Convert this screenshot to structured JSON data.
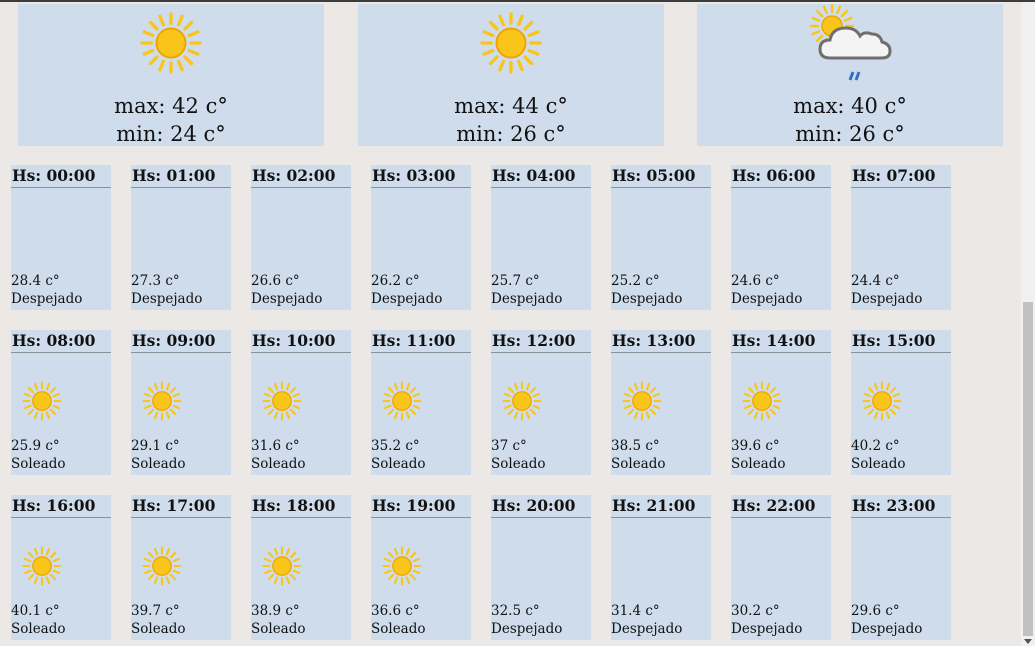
{
  "days": [
    {
      "icon": "sun-icon",
      "max": "max: 42 c°",
      "min": "min: 24 c°",
      "selected": true
    },
    {
      "icon": "sun-icon",
      "max": "max: 44 c°",
      "min": "min: 26 c°",
      "selected": false
    },
    {
      "icon": "sun-cloud-rain-icon",
      "max": "max: 40 c°",
      "min": "min: 26 c°",
      "selected": false
    }
  ],
  "hours": [
    {
      "time": "Hs: 00:00",
      "temp": "28.4 c°",
      "cond": "Despejado",
      "icon": "moon-icon"
    },
    {
      "time": "Hs: 01:00",
      "temp": "27.3 c°",
      "cond": "Despejado",
      "icon": "moon-icon"
    },
    {
      "time": "Hs: 02:00",
      "temp": "26.6 c°",
      "cond": "Despejado",
      "icon": "moon-icon"
    },
    {
      "time": "Hs: 03:00",
      "temp": "26.2 c°",
      "cond": "Despejado",
      "icon": "moon-icon"
    },
    {
      "time": "Hs: 04:00",
      "temp": "25.7 c°",
      "cond": "Despejado",
      "icon": "moon-icon"
    },
    {
      "time": "Hs: 05:00",
      "temp": "25.2 c°",
      "cond": "Despejado",
      "icon": "moon-icon"
    },
    {
      "time": "Hs: 06:00",
      "temp": "24.6 c°",
      "cond": "Despejado",
      "icon": "moon-icon"
    },
    {
      "time": "Hs: 07:00",
      "temp": "24.4 c°",
      "cond": "Despejado",
      "icon": "moon-icon"
    },
    {
      "time": "Hs: 08:00",
      "temp": "25.9 c°",
      "cond": "Soleado",
      "icon": "sun-icon"
    },
    {
      "time": "Hs: 09:00",
      "temp": "29.1 c°",
      "cond": "Soleado",
      "icon": "sun-icon"
    },
    {
      "time": "Hs: 10:00",
      "temp": "31.6 c°",
      "cond": "Soleado",
      "icon": "sun-icon"
    },
    {
      "time": "Hs: 11:00",
      "temp": "35.2 c°",
      "cond": "Soleado",
      "icon": "sun-icon"
    },
    {
      "time": "Hs: 12:00",
      "temp": "37 c°",
      "cond": "Soleado",
      "icon": "sun-icon"
    },
    {
      "time": "Hs: 13:00",
      "temp": "38.5 c°",
      "cond": "Soleado",
      "icon": "sun-icon"
    },
    {
      "time": "Hs: 14:00",
      "temp": "39.6 c°",
      "cond": "Soleado",
      "icon": "sun-icon"
    },
    {
      "time": "Hs: 15:00",
      "temp": "40.2 c°",
      "cond": "Soleado",
      "icon": "sun-icon"
    },
    {
      "time": "Hs: 16:00",
      "temp": "40.1 c°",
      "cond": "Soleado",
      "icon": "sun-icon"
    },
    {
      "time": "Hs: 17:00",
      "temp": "39.7 c°",
      "cond": "Soleado",
      "icon": "sun-icon"
    },
    {
      "time": "Hs: 18:00",
      "temp": "38.9 c°",
      "cond": "Soleado",
      "icon": "sun-icon"
    },
    {
      "time": "Hs: 19:00",
      "temp": "36.6 c°",
      "cond": "Soleado",
      "icon": "sun-icon"
    },
    {
      "time": "Hs: 20:00",
      "temp": "32.5 c°",
      "cond": "Despejado",
      "icon": "moon-icon"
    },
    {
      "time": "Hs: 21:00",
      "temp": "31.4 c°",
      "cond": "Despejado",
      "icon": "moon-icon"
    },
    {
      "time": "Hs: 22:00",
      "temp": "30.2 c°",
      "cond": "Despejado",
      "icon": "moon-icon"
    },
    {
      "time": "Hs: 23:00",
      "temp": "29.6 c°",
      "cond": "Despejado",
      "icon": "moon-icon"
    }
  ],
  "colors": {
    "card": "#cfdcec",
    "card_selected": "#adbfd6",
    "sun": "#f9c51a",
    "moon": "#1d72c9"
  }
}
